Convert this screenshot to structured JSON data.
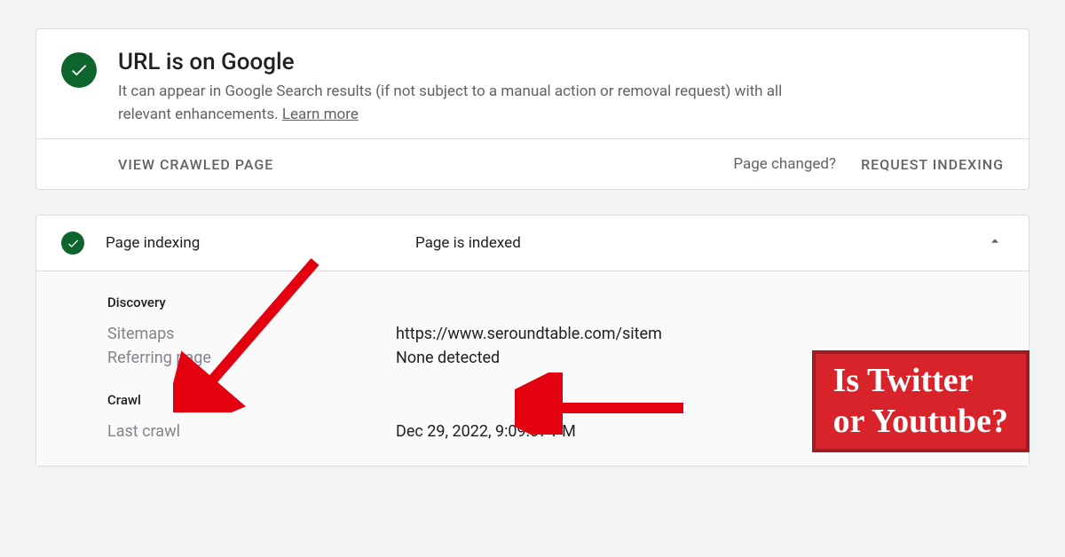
{
  "top": {
    "title": "URL is on Google",
    "subtitle_prefix": "It can appear in Google Search results (if not subject to a manual action or removal request) with all relevant enhancements. ",
    "learn_more": "Learn more",
    "view_crawled": "VIEW CRAWLED PAGE",
    "page_changed": "Page changed?",
    "request_indexing": "REQUEST INDEXING"
  },
  "panel": {
    "title": "Page indexing",
    "status": "Page is indexed",
    "discovery": {
      "heading": "Discovery",
      "sitemaps_label": "Sitemaps",
      "sitemaps_value": "https://www.seroundtable.com/sitem",
      "referring_label": "Referring page",
      "referring_value": "None detected"
    },
    "crawl": {
      "heading": "Crawl",
      "last_crawl_label": "Last crawl",
      "last_crawl_value": "Dec 29, 2022, 9:09:07 PM"
    }
  },
  "annotation": {
    "line1": "Is Twitter",
    "line2": "or Youtube?"
  }
}
